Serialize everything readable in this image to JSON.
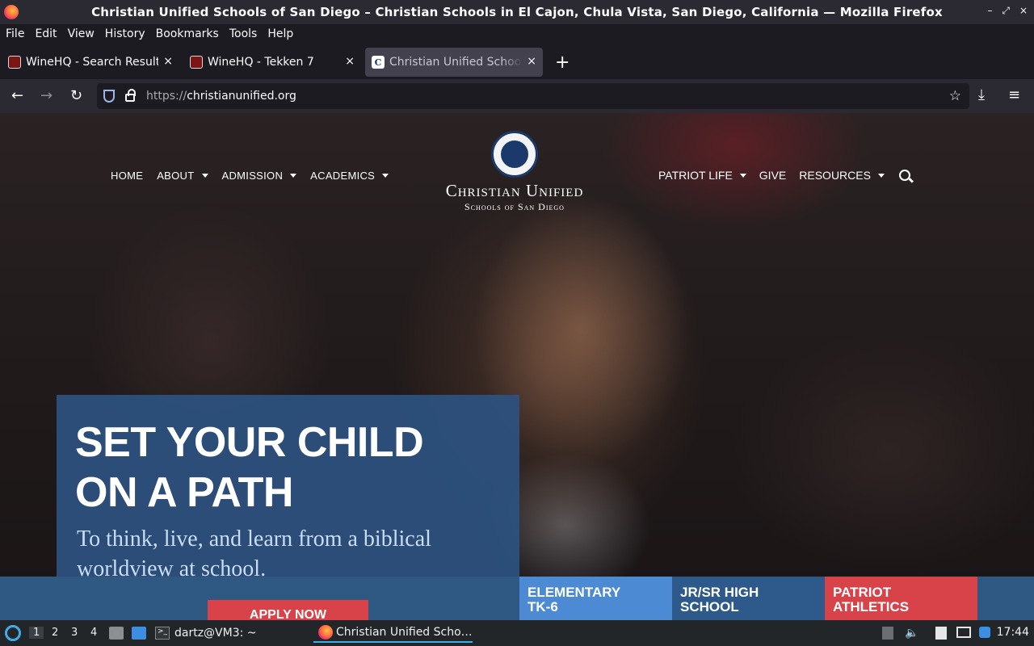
{
  "window": {
    "title": "Christian Unified Schools of San Diego – Christian Schools in El Cajon, Chula Vista, San Diego, California — Mozilla Firefox",
    "minimize": "–",
    "maximize": "⤢",
    "close": "×"
  },
  "menubar": [
    "File",
    "Edit",
    "View",
    "History",
    "Bookmarks",
    "Tools",
    "Help"
  ],
  "tabs": [
    {
      "label": "WineHQ - Search Results",
      "favicon": "wine-glass-icon",
      "active": false
    },
    {
      "label": "WineHQ - Tekken 7",
      "favicon": "wine-glass-icon",
      "active": false
    },
    {
      "label": "Christian Unified Schools",
      "favicon": "cu-c-icon",
      "active": true
    }
  ],
  "tab_close": "×",
  "new_tab": "+",
  "nav": {
    "back": "←",
    "forward": "→",
    "reload": "↻",
    "url_protocol": "https://",
    "url_host": "christianunified.org",
    "bookmark": "☆",
    "downloads": "⤓",
    "menu": "≡"
  },
  "site": {
    "nav_left": [
      "HOME",
      "ABOUT",
      "ADMISSION",
      "ACADEMICS"
    ],
    "nav_right": [
      "PATRIOT LIFE",
      "GIVE",
      "RESOURCES"
    ],
    "logo_line1": "Christian Unified",
    "logo_line2": "Schools of San Diego",
    "hero_title_1": "SET YOUR CHILD",
    "hero_title_2": "ON A PATH",
    "hero_subtitle_1": "To think, live, and learn from a biblical",
    "hero_subtitle_2": "worldview at school.",
    "apply_button": "APPLY NOW",
    "tiles": [
      {
        "line1": "ELEMENTARY",
        "line2": "TK-6"
      },
      {
        "line1": "JR/SR HIGH",
        "line2": "SCHOOL"
      },
      {
        "line1": "PATRIOT",
        "line2": "ATHLETICS"
      }
    ]
  },
  "taskbar": {
    "workspaces": [
      "1",
      "2",
      "3",
      "4"
    ],
    "terminal_label": "dartz@VM3: ~",
    "firefox_label": "Christian Unified Scho…",
    "clock": "17:44"
  }
}
